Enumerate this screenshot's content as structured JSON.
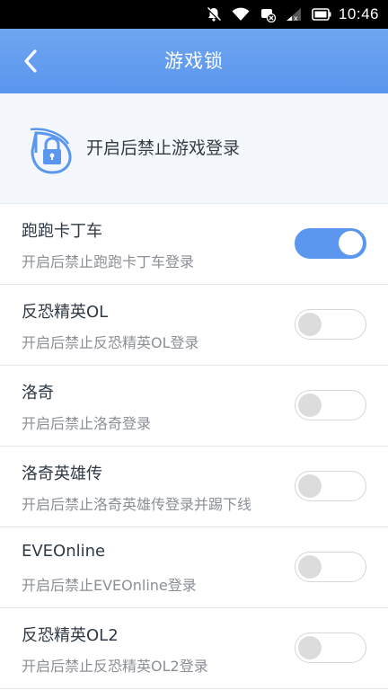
{
  "status_bar": {
    "time": "10:46",
    "icons": [
      "notifications-off-icon",
      "wifi-icon",
      "vpn-blocked-icon",
      "signal-icon",
      "battery-icon"
    ]
  },
  "header": {
    "back_icon": "chevron-left-icon",
    "title": "游戏锁"
  },
  "banner": {
    "icon": "lock-shield-icon",
    "text": "开启后禁止游戏登录"
  },
  "games": [
    {
      "name": "跑跑卡丁车",
      "desc": "开启后禁止跑跑卡丁车登录",
      "enabled": true
    },
    {
      "name": "反恐精英OL",
      "desc": "开启后禁止反恐精英OL登录",
      "enabled": false
    },
    {
      "name": "洛奇",
      "desc": "开启后禁止洛奇登录",
      "enabled": false
    },
    {
      "name": "洛奇英雄传",
      "desc": "开启后禁止洛奇英雄传登录并踢下线",
      "enabled": false
    },
    {
      "name": "EVEOnline",
      "desc": "开启后禁止EVEOnline登录",
      "enabled": false
    },
    {
      "name": "反恐精英OL2",
      "desc": "开启后禁止反恐精英OL2登录",
      "enabled": false
    }
  ],
  "colors": {
    "accent": "#5b97ef",
    "header": "#6fa6f0",
    "toggle_off_knob": "#dcdcdc"
  }
}
